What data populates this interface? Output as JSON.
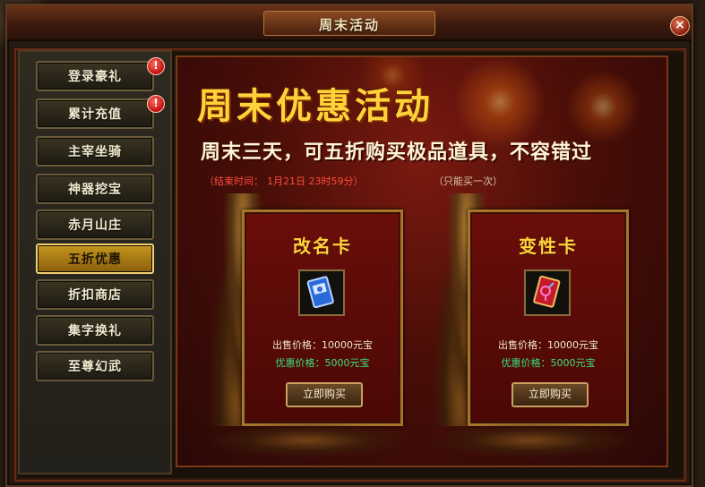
{
  "window": {
    "title": "周末活动"
  },
  "close_symbol": "×",
  "badge_symbol": "!",
  "sidebar": {
    "items": [
      {
        "label": "登录豪礼",
        "badge": true,
        "active": false
      },
      {
        "label": "累计充值",
        "badge": true,
        "active": false
      },
      {
        "label": "主宰坐骑",
        "badge": false,
        "active": false
      },
      {
        "label": "神器挖宝",
        "badge": false,
        "active": false
      },
      {
        "label": "赤月山庄",
        "badge": false,
        "active": false
      },
      {
        "label": "五折优惠",
        "badge": false,
        "active": true
      },
      {
        "label": "折扣商店",
        "badge": false,
        "active": false
      },
      {
        "label": "集字换礼",
        "badge": false,
        "active": false
      },
      {
        "label": "至尊幻武",
        "badge": false,
        "active": false
      }
    ]
  },
  "banner": {
    "headline": "周末优惠活动",
    "subline": "周末三天，可五折购买极品道具，不容错过",
    "end_time_label": "（结束时间：",
    "end_time_value": "1月21日   23时59分）",
    "purchase_limit": "（只能买一次）"
  },
  "cards": [
    {
      "title": "改名卡",
      "icon": "rename-card-icon",
      "orig_price": "出售价格：10000元宝",
      "sale_price": "优惠价格：5000元宝",
      "buy_label": "立即购买"
    },
    {
      "title": "变性卡",
      "icon": "gender-change-card-icon",
      "orig_price": "出售价格：10000元宝",
      "sale_price": "优惠价格：5000元宝",
      "buy_label": "立即购买"
    }
  ],
  "colors": {
    "accent_gold": "#ffd23a",
    "sale_green": "#3ae07a",
    "deadline_red": "#ff4a3a"
  }
}
